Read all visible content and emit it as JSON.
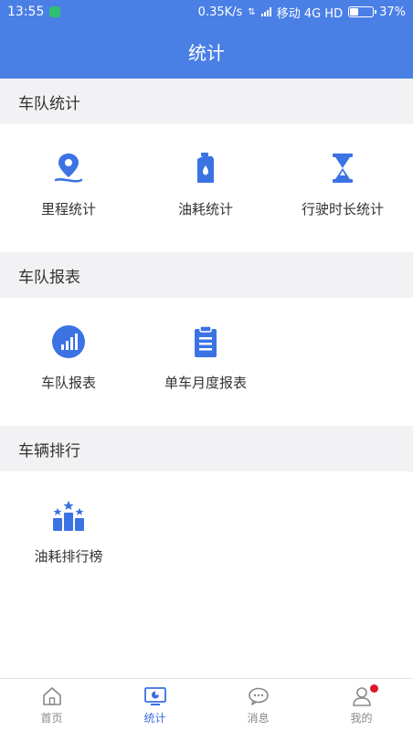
{
  "status_bar": {
    "time": "13:55",
    "speed": "0.35K/s",
    "carrier": "移动 4G HD",
    "battery": "37%",
    "battery_level": 0.37
  },
  "header": {
    "title": "统计"
  },
  "sections": [
    {
      "title": "车队统计",
      "items": [
        {
          "label": "里程统计",
          "icon": "map-pin-route-icon"
        },
        {
          "label": "油耗统计",
          "icon": "fuel-can-icon"
        },
        {
          "label": "行驶时长统计",
          "icon": "hourglass-icon"
        }
      ]
    },
    {
      "title": "车队报表",
      "items": [
        {
          "label": "车队报表",
          "icon": "bar-chart-circle-icon"
        },
        {
          "label": "单车月度报表",
          "icon": "clipboard-icon"
        }
      ]
    },
    {
      "title": "车辆排行",
      "items": [
        {
          "label": "油耗排行榜",
          "icon": "ranking-podium-icon"
        }
      ]
    }
  ],
  "bottom_nav": [
    {
      "label": "首页",
      "icon": "home-icon",
      "active": false
    },
    {
      "label": "统计",
      "icon": "monitor-chart-icon",
      "active": true
    },
    {
      "label": "消息",
      "icon": "chat-bubbles-icon",
      "active": false
    },
    {
      "label": "我的",
      "icon": "user-icon",
      "active": false,
      "badge_dot": true
    }
  ],
  "colors": {
    "primary": "#4a7fe6",
    "icon_blue": "#3b73e3",
    "section_bg": "#f2f2f4",
    "badge_red": "#e0182c"
  }
}
